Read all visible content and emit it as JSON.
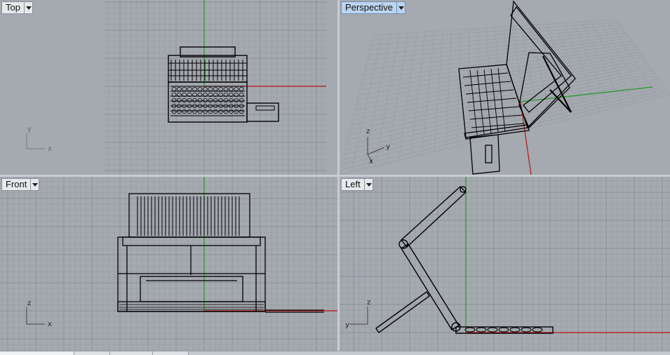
{
  "viewports": {
    "top": {
      "label": "Top",
      "axis_1": "y",
      "axis_2": "x"
    },
    "perspective": {
      "label": "Perspective",
      "axis_1": "z",
      "axis_2": "y",
      "axis_3": "x"
    },
    "front": {
      "label": "Front",
      "axis_1": "z",
      "axis_2": "x"
    },
    "left": {
      "label": "Left",
      "axis_1": "z",
      "axis_2": "y"
    }
  },
  "colors": {
    "viewport_bg": "#a5a9b0",
    "grid_minor": "#9a9ea5",
    "grid_major": "#8a8e96",
    "x_axis": "#b51616",
    "y_axis": "#1f9a1f",
    "active_label_bg": "#bcd4ee"
  },
  "active_viewport": "perspective"
}
